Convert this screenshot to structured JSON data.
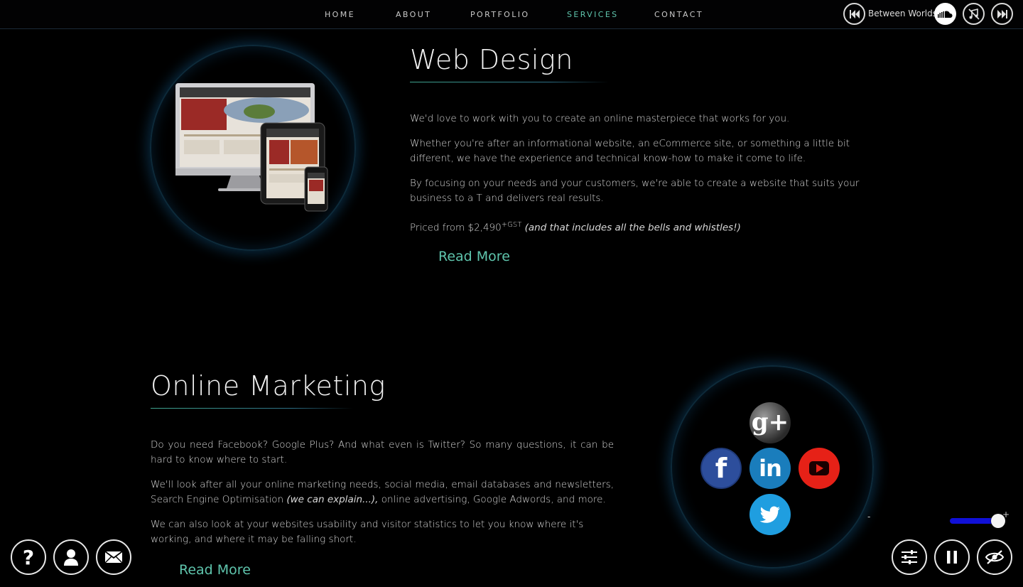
{
  "nav": {
    "items": [
      {
        "label": "HOME",
        "active": false
      },
      {
        "label": "ABOUT",
        "active": false
      },
      {
        "label": "PORTFOLIO",
        "active": false
      },
      {
        "label": "SERVICES",
        "active": true
      },
      {
        "label": "CONTACT",
        "active": false
      }
    ]
  },
  "player": {
    "track_title": "Between Worlds",
    "icons": [
      "previous-track-icon",
      "soundcloud-icon",
      "music-off-icon",
      "next-track-icon"
    ]
  },
  "web_design": {
    "title": "Web Design",
    "p1": "We'd love to work with you to create an online masterpiece that works for you.",
    "p2": "Whether you're after an informational website, an eCommerce site, or something a little bit different, we have the experience and technical know-how to make it come to life.",
    "p3": "By focusing on your needs and your customers, we're able to create a website that suits your business to a T and delivers real results.",
    "price_prefix": "Priced from $2,490",
    "price_sup": "+GST",
    "price_note": "(and that includes all the bells and whistles!)",
    "read_more": "Read More"
  },
  "online_marketing": {
    "title": "Online Marketing",
    "p1": "Do you need Facebook? Google Plus? And what even is Twitter? So many questions, it can be hard to know where to start.",
    "p2_before": "We'll look after all your online marketing needs, social media, email databases and newsletters, Search Engine Optimisation",
    "p2_em": "(we can explain...),",
    "p2_after": "online advertising, Google Adwords, and more.",
    "p3": "We can also look at your websites usability and visitor statistics to let you know where it's working, and where it may be falling short.",
    "read_more": "Read More"
  },
  "social_icons": {
    "google_plus": "g+",
    "facebook": "f",
    "linkedin": "in",
    "youtube": "youtube-icon",
    "twitter": "twitter-icon"
  },
  "volume": {
    "minus": "-",
    "plus": "+",
    "level": 0.95
  },
  "colors": {
    "accent": "#5fc5ad",
    "facebook": "#3b5998",
    "linkedin": "#0e76a8",
    "youtube": "#e62117",
    "twitter": "#1da1f2",
    "volume": "#1010d8"
  }
}
